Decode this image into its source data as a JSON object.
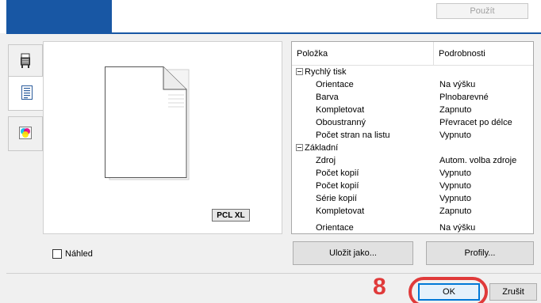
{
  "header": {
    "apply_label": "Použít"
  },
  "sidebar": {
    "tabs": [
      {
        "icon": "printer-icon"
      },
      {
        "icon": "document-icon"
      },
      {
        "icon": "color-icon"
      }
    ]
  },
  "preview": {
    "format_badge": "PCL XL"
  },
  "details": {
    "columns": [
      "Položka",
      "Podrobnosti"
    ],
    "rows": [
      {
        "label": "Rychlý tisk",
        "value": "",
        "group": true
      },
      {
        "label": "Orientace",
        "value": "Na výšku"
      },
      {
        "label": "Barva",
        "value": "Plnobarevné"
      },
      {
        "label": "Kompletovat",
        "value": "Zapnuto"
      },
      {
        "label": "Oboustranný",
        "value": "Převracet po délce"
      },
      {
        "label": "Počet stran na listu",
        "value": "Vypnuto"
      },
      {
        "label": "Základní",
        "value": "",
        "group": true
      },
      {
        "label": "Zdroj",
        "value": "Autom. volba zdroje"
      },
      {
        "label": "Počet kopií",
        "value": "Vypnuto"
      },
      {
        "label": "Počet kopií",
        "value": "Vypnuto"
      },
      {
        "label": "Série kopií",
        "value": "Vypnuto"
      },
      {
        "label": "Kompletovat",
        "value": "Zapnuto"
      },
      {
        "label": "Orientace",
        "value": "Na výšku"
      }
    ]
  },
  "footer": {
    "preview_label": "Náhled",
    "preview_checked": false,
    "save_as_label": "Uložit jako...",
    "profiles_label": "Profily...",
    "ok_label": "OK",
    "cancel_label": "Zrušit",
    "step_number": "8"
  },
  "colors": {
    "accent": "#1857a4",
    "highlight": "#e03a3a",
    "ok_border": "#0078d7"
  }
}
